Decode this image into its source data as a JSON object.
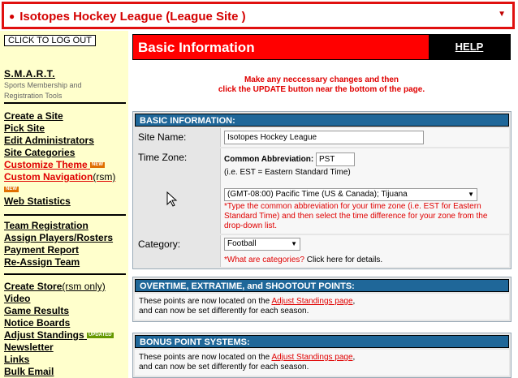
{
  "site_selector": {
    "value": "Isotopes Hockey League (League Site )"
  },
  "sidebar": {
    "logout": "CLICK TO LOG OUT",
    "smart_title": "S.M.A.R.T.",
    "smart_sub1": "Sports Membership and",
    "smart_sub2": "Registration Tools",
    "group1": [
      "Create a Site",
      "Pick Site",
      "Edit Administrators",
      "Site Categories",
      "Customize Theme",
      "Custom Navigation",
      "(rsm)",
      "Web Statistics"
    ],
    "new_badge": "NEW",
    "group2": [
      "Team Registration",
      "Assign Players/Rosters",
      "Payment Report",
      "Re-Assign Team"
    ],
    "group3": [
      "Create Store",
      "(rsm only)",
      "Video",
      "Game Results",
      "Notice Boards",
      "Adjust Standings",
      "Newsletter",
      "Links",
      "Bulk Email"
    ],
    "updated_badge": "UPDATED"
  },
  "header": {
    "title": "Basic Information",
    "help": "HELP"
  },
  "notice": {
    "line1": "Make any neccessary changes and then",
    "line2": "click the UPDATE button near the bottom of the page."
  },
  "basic": {
    "heading": "BASIC INFORMATION:",
    "site_name_label": "Site Name:",
    "site_name_value": "Isotopes Hockey League",
    "timezone_label": "Time Zone:",
    "common_abbr_label": "Common Abbreviation:",
    "common_abbr_value": "PST",
    "abbr_example": "(i.e. EST = Eastern Standard Time)",
    "tz_select": "(GMT-08:00) Pacific Time (US & Canada); Tijuana",
    "tz_note": "*Type the common abbreviation for your time zone (i.e. EST for Eastern Standard Time) and then select the time difference for your zone from the drop-down list.",
    "category_label": "Category:",
    "category_value": "Football",
    "category_link": "*What are categories?",
    "category_help": " Click here for details."
  },
  "overtime": {
    "heading": "OVERTIME, EXTRATIME, and SHOOTOUT POINTS:",
    "text1": "These points are now located on the ",
    "link": "Adjust Standings page",
    "text2": ",",
    "text3": "and can now be set differently for each season."
  },
  "bonus": {
    "heading": "BONUS POINT SYSTEMS:",
    "text1": "These points are now located on the ",
    "link": "Adjust Standings page",
    "text2": ",",
    "text3": "and can now be set differently for each season."
  }
}
